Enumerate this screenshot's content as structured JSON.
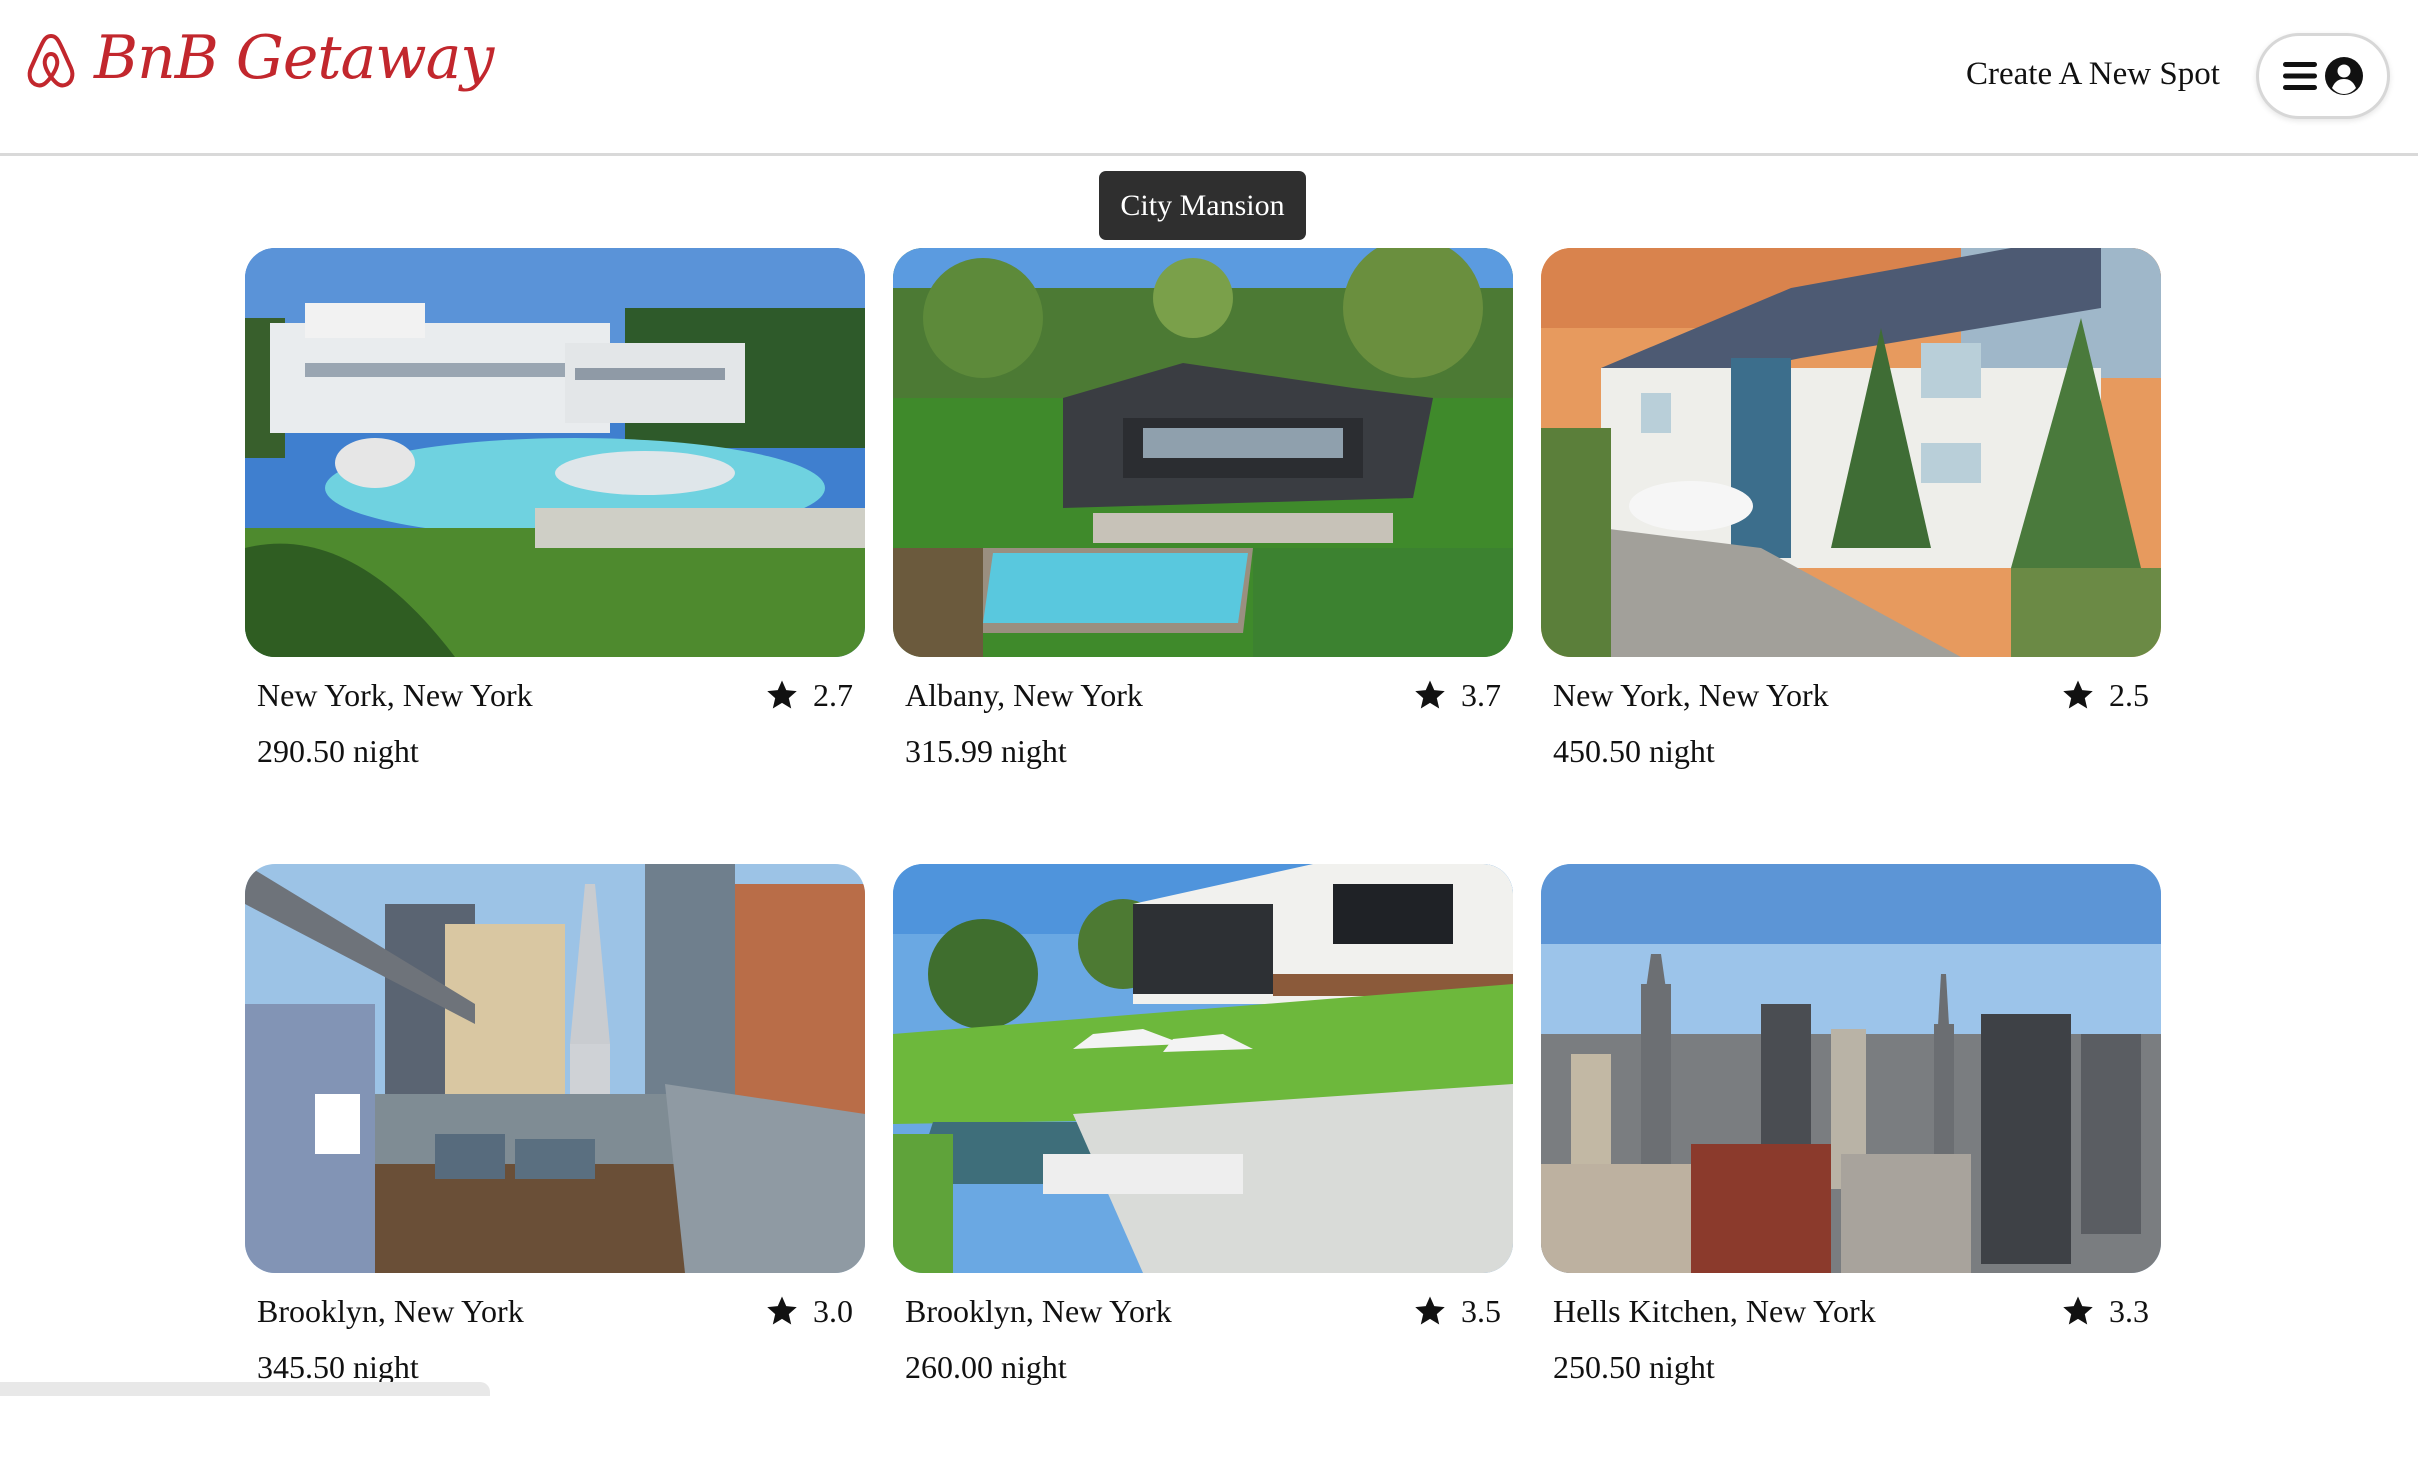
{
  "header": {
    "brand_name": "BnB Getaway",
    "brand_icon": "airbnb-logo-icon",
    "brand_color": "#c2272d",
    "create_spot_label": "Create A New Spot",
    "menu_icon": "hamburger-menu-icon",
    "profile_icon": "user-circle-icon"
  },
  "tooltip": {
    "text": "City Mansion"
  },
  "spots": [
    {
      "location": "New York, New York",
      "rating": "2.7",
      "price": "290.50 night",
      "photo": "mansion-pool-photo"
    },
    {
      "location": "Albany, New York",
      "rating": "3.7",
      "price": "315.99 night",
      "photo": "modern-house-pool-photo"
    },
    {
      "location": "New York, New York",
      "rating": "2.5",
      "price": "450.50 night",
      "photo": "white-house-driveway-photo"
    },
    {
      "location": "Brooklyn, New York",
      "rating": "3.0",
      "price": "345.50 night",
      "photo": "rooftop-terrace-photo"
    },
    {
      "location": "Brooklyn, New York",
      "rating": "3.5",
      "price": "260.00 night",
      "photo": "lawn-pool-house-photo"
    },
    {
      "location": "Hells Kitchen, New York",
      "rating": "3.3",
      "price": "250.50 night",
      "photo": "manhattan-skyline-photo"
    }
  ]
}
